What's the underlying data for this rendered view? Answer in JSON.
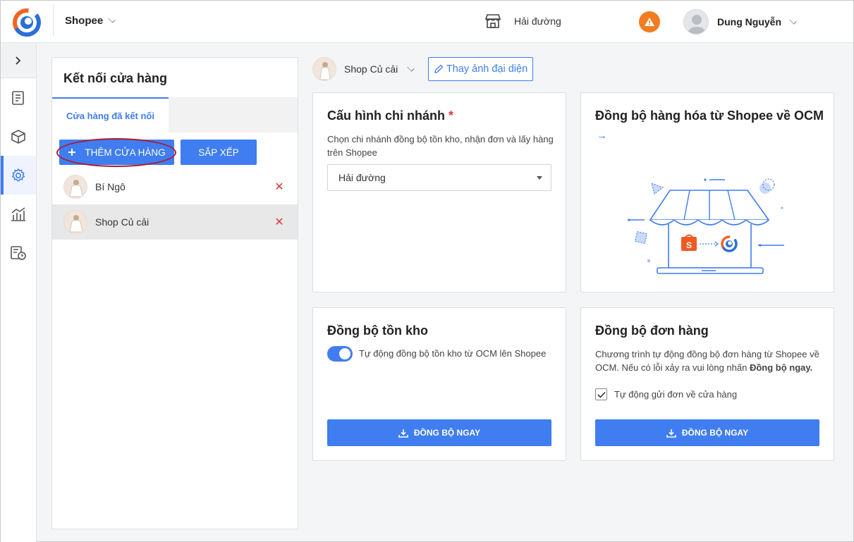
{
  "header": {
    "channel": "Shopee",
    "branch": "Hải đường",
    "user_name": "Dung Nguyễn"
  },
  "sidebar": {
    "items": [
      {
        "icon": "expand-icon"
      },
      {
        "icon": "order-list-icon"
      },
      {
        "icon": "box-icon"
      },
      {
        "icon": "settings-icon",
        "active": true
      },
      {
        "icon": "analytics-icon"
      },
      {
        "icon": "report-clock-icon"
      }
    ]
  },
  "store_panel": {
    "title": "Kết nối cửa hàng",
    "tab_connected": "Cửa hàng đã kết nối",
    "add_button": "THÊM CỬA HÀNG",
    "sort_button": "SẮP XẾP",
    "stores": [
      {
        "name": "Bí Ngô",
        "selected": false
      },
      {
        "name": "Shop Củ cải",
        "selected": true
      }
    ]
  },
  "shop": {
    "name": "Shop Củ cải",
    "change_avatar": "Thay ảnh đại diện"
  },
  "branch_card": {
    "title": "Cấu hình chi nhánh",
    "required_mark": "*",
    "description": "Chọn chi nhánh đồng bộ tồn kho, nhận đơn và lấy hàng trên Shopee",
    "selected_branch": "Hải đường"
  },
  "product_sync_card": {
    "title": "Đồng bộ hàng hóa từ Shopee về OCM",
    "link_arrow": "→"
  },
  "stock_sync_card": {
    "title": "Đồng bộ tồn kho",
    "toggle_label": "Tự động đồng bộ tồn kho từ OCM lên Shopee",
    "toggle_on": true,
    "button": "ĐỒNG BỘ NGAY"
  },
  "order_sync_card": {
    "title": "Đồng bộ đơn hàng",
    "description": "Chương trình tự động đồng bộ đơn hàng từ Shopee về OCM. Nếu có lỗi xảy ra vui lòng nhấn",
    "description_bold": "Đồng bộ ngay.",
    "checkbox_label": "Tự động gửi đơn về cửa hàng",
    "checkbox_checked": true,
    "button": "ĐỒNG BỘ NGAY"
  },
  "colors": {
    "accent": "#3f7df0",
    "warning": "#f37c20",
    "delete": "#e03a3a"
  }
}
